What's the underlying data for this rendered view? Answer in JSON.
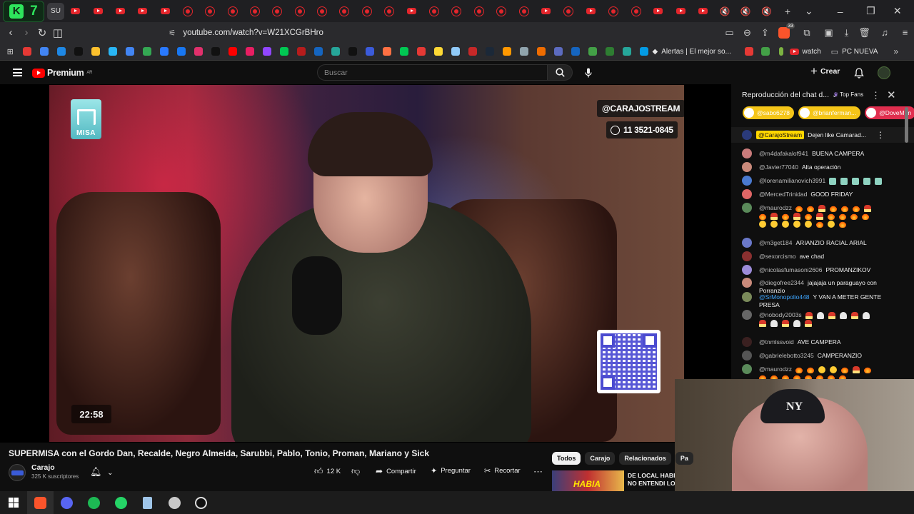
{
  "browser": {
    "k7_badge": "7",
    "k7_letter": "K",
    "su_tab": "SU",
    "url": "youtube.com/watch?v=W21XCGrBHro",
    "brave_count": "33",
    "bookmarks": {
      "alertas": "Alertas | El mejor so...",
      "watch": "watch",
      "pc_nueva": "PC NUEVA"
    }
  },
  "youtube": {
    "logo_text": "Premium",
    "region": "AR",
    "search_placeholder": "Buscar",
    "create_label": "Crear"
  },
  "video": {
    "overlay_handle": "@CARAJOSTREAM",
    "overlay_phone": "11 3521-0845",
    "brand_logo": "MISA",
    "timer": "22:58",
    "title": "SUPERMISA con el Gordo Dan, Recalde, Negro Almeida, Sarubbi, Pablo, Tonio, Proman, Mariano y Sick",
    "channel": "Carajo",
    "subscribers": "325 K suscriptores",
    "likes": "12 K",
    "share_label": "Compartir",
    "ask_label": "Preguntar",
    "clip_label": "Recortar"
  },
  "related": {
    "tabs": [
      "Todos",
      "Carajo",
      "Relacionados",
      "Pa"
    ],
    "thumb_text": "HABIA",
    "first_title_line1": "DE LOCAL HABIA",
    "first_title_line2": "NO ENTENDI LOS"
  },
  "chat": {
    "header_title": "Reproducción del chat d...",
    "top_fans": "Top Fans",
    "pins": [
      {
        "handle": "@sabo6278",
        "color": "#f5c518"
      },
      {
        "handle": "@brianferman...",
        "color": "#f5c518"
      },
      {
        "handle": "@DoveMen",
        "color": "#e02e4e"
      }
    ],
    "pinned": {
      "author": "@CarajoStream",
      "text": "Dejen like Camarad..."
    },
    "messages": [
      {
        "author": "@m4dafakalof941",
        "text": "BUENA CAMPERA",
        "avatar": "#c97b7b"
      },
      {
        "author": "@Javier77040",
        "text": "Alta operación",
        "avatar": "#c98a7b"
      },
      {
        "author": "@lorenamilianovich3991",
        "text": "",
        "emojis": [
          "statue",
          "statue",
          "statue",
          "statue",
          "statue"
        ],
        "avatar": "#4a7ad0"
      },
      {
        "author": "@MercedTrinidad",
        "text": "GOOD FRIDAY",
        "avatar": "#e06666"
      },
      {
        "author": "@maurodzz",
        "text": "",
        "emojis": [
          "fire",
          "fire",
          "hat",
          "fire",
          "fire",
          "fire",
          "hat"
        ],
        "emojis2": [
          "fire",
          "hat",
          "fire",
          "hat",
          "fire",
          "hat",
          "fire",
          "fire",
          "fire",
          "fire"
        ],
        "emojis3": [
          "face",
          "face",
          "face",
          "face",
          "face",
          "fire",
          "face",
          "fire"
        ],
        "avatar": "#5a8a5a"
      },
      {
        "author": "@m3get184",
        "text": "ARIANZIO RACIAL ARIAL",
        "avatar": "#6a78c9"
      },
      {
        "author": "@sexorcismo",
        "text": "ave chad",
        "avatar": "#8a3030"
      },
      {
        "author": "@nicolasfumasoni2606",
        "text": "PROMANZIKOV",
        "avatar": "#9c8bd8"
      },
      {
        "author": "@diegofree2344",
        "text": "jajajaja un paraguayo con Porranzio",
        "avatar": "#c98a7b"
      },
      {
        "author": "@SrMonopolio448",
        "text": "Y VAN A METER GENTE PRESA",
        "avatar": "#7a8a5a"
      },
      {
        "author": "@nobody2003s",
        "text": "",
        "emojis": [
          "hat",
          "helm",
          "hat",
          "helm",
          "hat",
          "helm"
        ],
        "emojis2": [
          "hat",
          "helm",
          "hat",
          "helm",
          "hat"
        ],
        "avatar": "#666666"
      },
      {
        "author": "@tnmlssvoid",
        "text": "AVE CAMPERA",
        "avatar": "#3a2020"
      },
      {
        "author": "@gabrielebotto3245",
        "text": "CAMPERANZIO",
        "avatar": "#555555"
      },
      {
        "author": "@maurodzz",
        "text": "",
        "emojis": [
          "fire",
          "fire",
          "face",
          "face",
          "fire",
          "hat",
          "fire"
        ],
        "emojis2": [
          "fire",
          "fire",
          "fire",
          "fire",
          "fire",
          "fire",
          "fire",
          "fire"
        ],
        "avatar": "#5a8a5a"
      }
    ]
  },
  "webcam": {
    "cap_logo": "NY"
  }
}
